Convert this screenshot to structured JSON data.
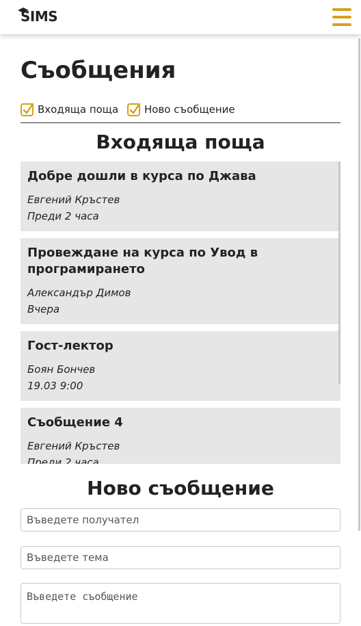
{
  "app": {
    "logo_text": "SIMS",
    "menu_icon": "hamburger-menu-icon"
  },
  "page": {
    "title": "Съобщения"
  },
  "tabs": [
    {
      "label": "Входяща поща",
      "icon": "checkbox-checked-icon"
    },
    {
      "label": "Ново съобщение",
      "icon": "checkbox-checked-icon"
    }
  ],
  "inbox": {
    "title": "Входяща поща",
    "messages": [
      {
        "subject": "Добре дошли в курса по Джава",
        "sender": "Евгений Кръстев",
        "time": "Преди 2 часа"
      },
      {
        "subject": "Провеждане на курса по Увод в програмирането",
        "sender": "Александър Димов",
        "time": "Вчера"
      },
      {
        "subject": "Гост-лектор",
        "sender": "Боян Бончев",
        "time": "19.03 9:00"
      },
      {
        "subject": "Съобщение 4",
        "sender": "Евгений Кръстев",
        "time": "Преди 2 часа"
      }
    ]
  },
  "compose": {
    "title": "Ново съобщение",
    "recipient_placeholder": "Въведете получател",
    "subject_placeholder": "Въведете тема",
    "message_placeholder": "Въведете съобщение"
  },
  "colors": {
    "accent": "#d4a017",
    "card_bg": "#e6e6e6"
  }
}
